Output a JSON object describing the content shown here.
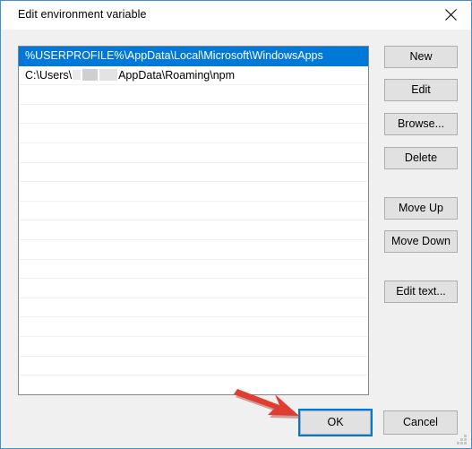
{
  "window": {
    "title": "Edit environment variable",
    "close_icon": "close-icon",
    "border_color": "#3e92cc",
    "background_color": "#f0f0f0",
    "titlebar_color": "#ffffff"
  },
  "listbox": {
    "selection_color": "#0078d7",
    "selected_index": 0,
    "total_visible_rows": 18,
    "entries": [
      {
        "text": "%USERPROFILE%\\AppData\\Local\\Microsoft\\WindowsApps",
        "selected": true,
        "redacted": false
      },
      {
        "text_before": "C:\\Users\\",
        "text_after": "AppData\\Roaming\\npm",
        "selected": false,
        "redacted": true
      }
    ]
  },
  "side_buttons": [
    {
      "id": "new",
      "label": "New"
    },
    {
      "id": "edit",
      "label": "Edit"
    },
    {
      "id": "browse",
      "label": "Browse..."
    },
    {
      "id": "delete",
      "label": "Delete"
    },
    {
      "id": "move_up",
      "label": "Move Up"
    },
    {
      "id": "move_down",
      "label": "Move Down"
    },
    {
      "id": "edit_text",
      "label": "Edit text..."
    }
  ],
  "footer_buttons": {
    "ok": {
      "label": "OK",
      "focused": true
    },
    "cancel": {
      "label": "Cancel",
      "focused": false
    }
  },
  "annotation": {
    "type": "arrow",
    "color": "#e03c31",
    "points_to": "ok-button",
    "direction": "down-right"
  }
}
